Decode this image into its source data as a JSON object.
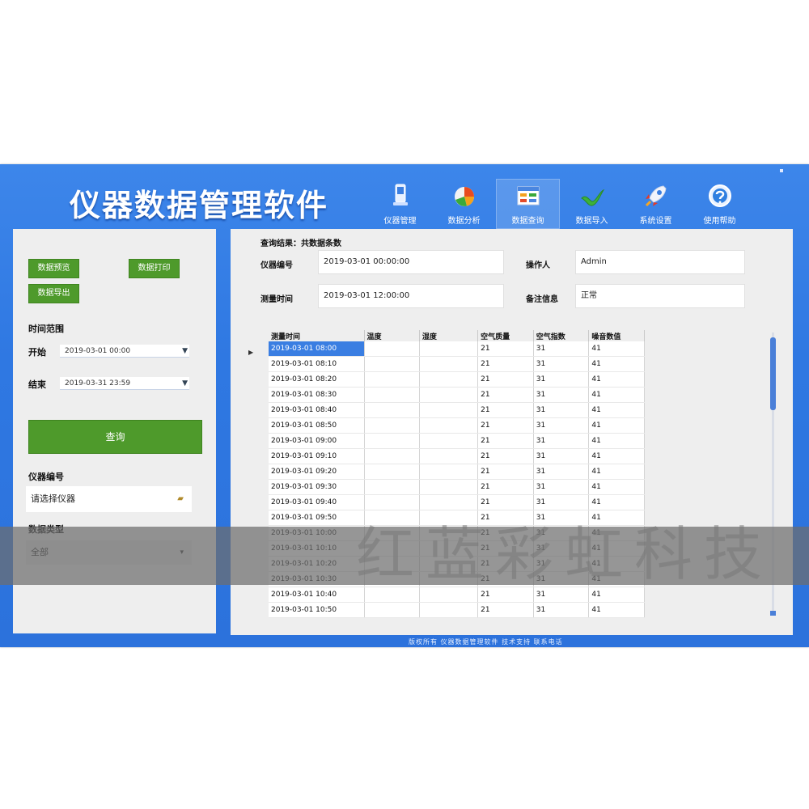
{
  "app": {
    "title": "仪器数据管理软件"
  },
  "toolbar": {
    "items": [
      {
        "label": "仪器管理",
        "icon": "instrument-icon"
      },
      {
        "label": "数据分析",
        "icon": "pie-chart-icon"
      },
      {
        "label": "数据查询",
        "icon": "table-window-icon",
        "active": true
      },
      {
        "label": "数据导入",
        "icon": "check-arrow-icon"
      },
      {
        "label": "系统设置",
        "icon": "rocket-icon"
      },
      {
        "label": "使用帮助",
        "icon": "help-globe-icon"
      }
    ]
  },
  "left_panel": {
    "button_a": "数据预览",
    "button_b": "数据打印",
    "button_c": "数据导出",
    "time_range_label": "时间范围",
    "start_label": "开始",
    "start_value": "2019-03-01 00:00",
    "end_label": "结束",
    "end_value": "2019-03-31 23:59",
    "query_button": "查询",
    "instrument_label": "仪器编号",
    "instrument_value": "请选择仪器",
    "type_label": "数据类型",
    "type_value": "全部"
  },
  "right_panel": {
    "header_text": "查询结果：共数据条数",
    "info": {
      "device_no_label": "仪器编号",
      "device_no_value": "2019-03-01 00:00:00",
      "operator_label": "操作人",
      "operator_value": "Admin",
      "measure_time_label": "测量时间",
      "measure_time_value": "2019-03-01 12:00:00",
      "remark_label": "备注信息",
      "remark_value": "正常"
    },
    "table": {
      "columns": [
        "测量时间",
        "温度",
        "湿度",
        "空气质量",
        "空气指数",
        "噪音数值"
      ],
      "rows": [
        [
          "2019-03-01 08:00",
          "",
          "",
          "21",
          "31",
          "41"
        ],
        [
          "2019-03-01 08:10",
          "",
          "",
          "21",
          "31",
          "41"
        ],
        [
          "2019-03-01 08:20",
          "",
          "",
          "21",
          "31",
          "41"
        ],
        [
          "2019-03-01 08:30",
          "",
          "",
          "21",
          "31",
          "41"
        ],
        [
          "2019-03-01 08:40",
          "",
          "",
          "21",
          "31",
          "41"
        ],
        [
          "2019-03-01 08:50",
          "",
          "",
          "21",
          "31",
          "41"
        ],
        [
          "2019-03-01 09:00",
          "",
          "",
          "21",
          "31",
          "41"
        ],
        [
          "2019-03-01 09:10",
          "",
          "",
          "21",
          "31",
          "41"
        ],
        [
          "2019-03-01 09:20",
          "",
          "",
          "21",
          "31",
          "41"
        ],
        [
          "2019-03-01 09:30",
          "",
          "",
          "21",
          "31",
          "41"
        ],
        [
          "2019-03-01 09:40",
          "",
          "",
          "21",
          "31",
          "41"
        ],
        [
          "2019-03-01 09:50",
          "",
          "",
          "21",
          "31",
          "41"
        ],
        [
          "2019-03-01 10:00",
          "",
          "",
          "21",
          "31",
          "41"
        ],
        [
          "2019-03-01 10:10",
          "",
          "",
          "21",
          "31",
          "41"
        ],
        [
          "2019-03-01 10:20",
          "",
          "",
          "21",
          "31",
          "41"
        ],
        [
          "2019-03-01 10:30",
          "",
          "",
          "21",
          "31",
          "41"
        ],
        [
          "2019-03-01 10:40",
          "",
          "",
          "21",
          "31",
          "41"
        ],
        [
          "2019-03-01 10:50",
          "",
          "",
          "21",
          "31",
          "41"
        ]
      ]
    }
  },
  "status_bar": "版权所有 仪器数据管理软件 技术支持 联系电话",
  "watermark": "红蓝彩虹科技",
  "colors": {
    "window_blue": "#2f78e2",
    "panel_gray": "#eeeeee",
    "button_green": "#4e9a2b",
    "selection_blue": "#3a7ee2"
  }
}
